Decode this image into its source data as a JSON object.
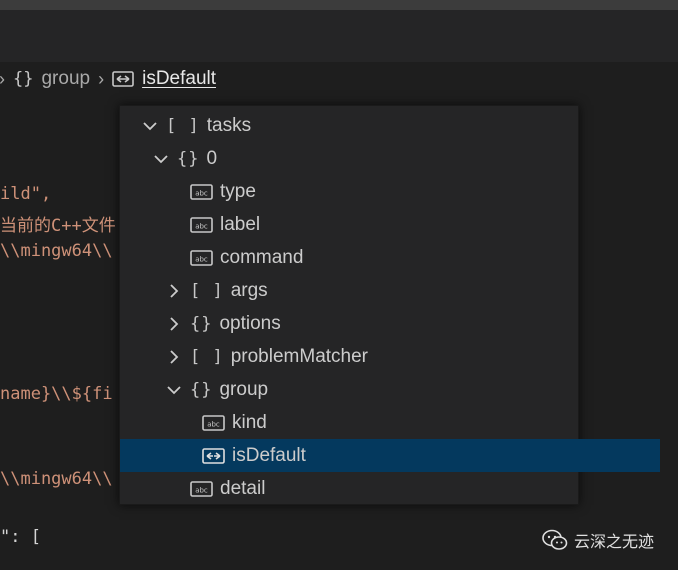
{
  "breadcrumb": {
    "items": [
      {
        "glyph": "{}",
        "label": "group"
      },
      {
        "label": "isDefault"
      }
    ]
  },
  "code_fragments": [
    {
      "text": "ild\","
    },
    {
      "text": "当前的C++文件"
    },
    {
      "text": "\\\\mingw64\\\\"
    },
    {
      "text": "name}\\\\${fi"
    },
    {
      "text": "\\\\mingw64\\\\"
    },
    {
      "text": "\": ["
    }
  ],
  "outline": {
    "items": [
      {
        "glyph": "[ ]",
        "label": "tasks",
        "expanded": true,
        "icon": "array-icon"
      },
      {
        "glyph": "{}",
        "label": "0",
        "expanded": true,
        "icon": "object-icon"
      },
      {
        "label": "type",
        "icon": "string-icon"
      },
      {
        "label": "label",
        "icon": "string-icon"
      },
      {
        "label": "command",
        "icon": "string-icon"
      },
      {
        "glyph": "[ ]",
        "label": "args",
        "expanded": false,
        "icon": "array-icon"
      },
      {
        "glyph": "{}",
        "label": "options",
        "expanded": false,
        "icon": "object-icon"
      },
      {
        "glyph": "[ ]",
        "label": "problemMatcher",
        "expanded": false,
        "icon": "array-icon"
      },
      {
        "glyph": "{}",
        "label": "group",
        "expanded": true,
        "icon": "object-icon"
      },
      {
        "label": "kind",
        "icon": "string-icon"
      },
      {
        "label": "isDefault",
        "icon": "boolean-icon",
        "selected": true
      },
      {
        "label": "detail",
        "icon": "string-icon"
      }
    ]
  },
  "watermark": {
    "label": "云深之无迹"
  },
  "colors": {
    "editor_bg": "#1e1e1e",
    "popup_bg": "#252526",
    "selection": "#04395e",
    "string": "#ce9178"
  }
}
